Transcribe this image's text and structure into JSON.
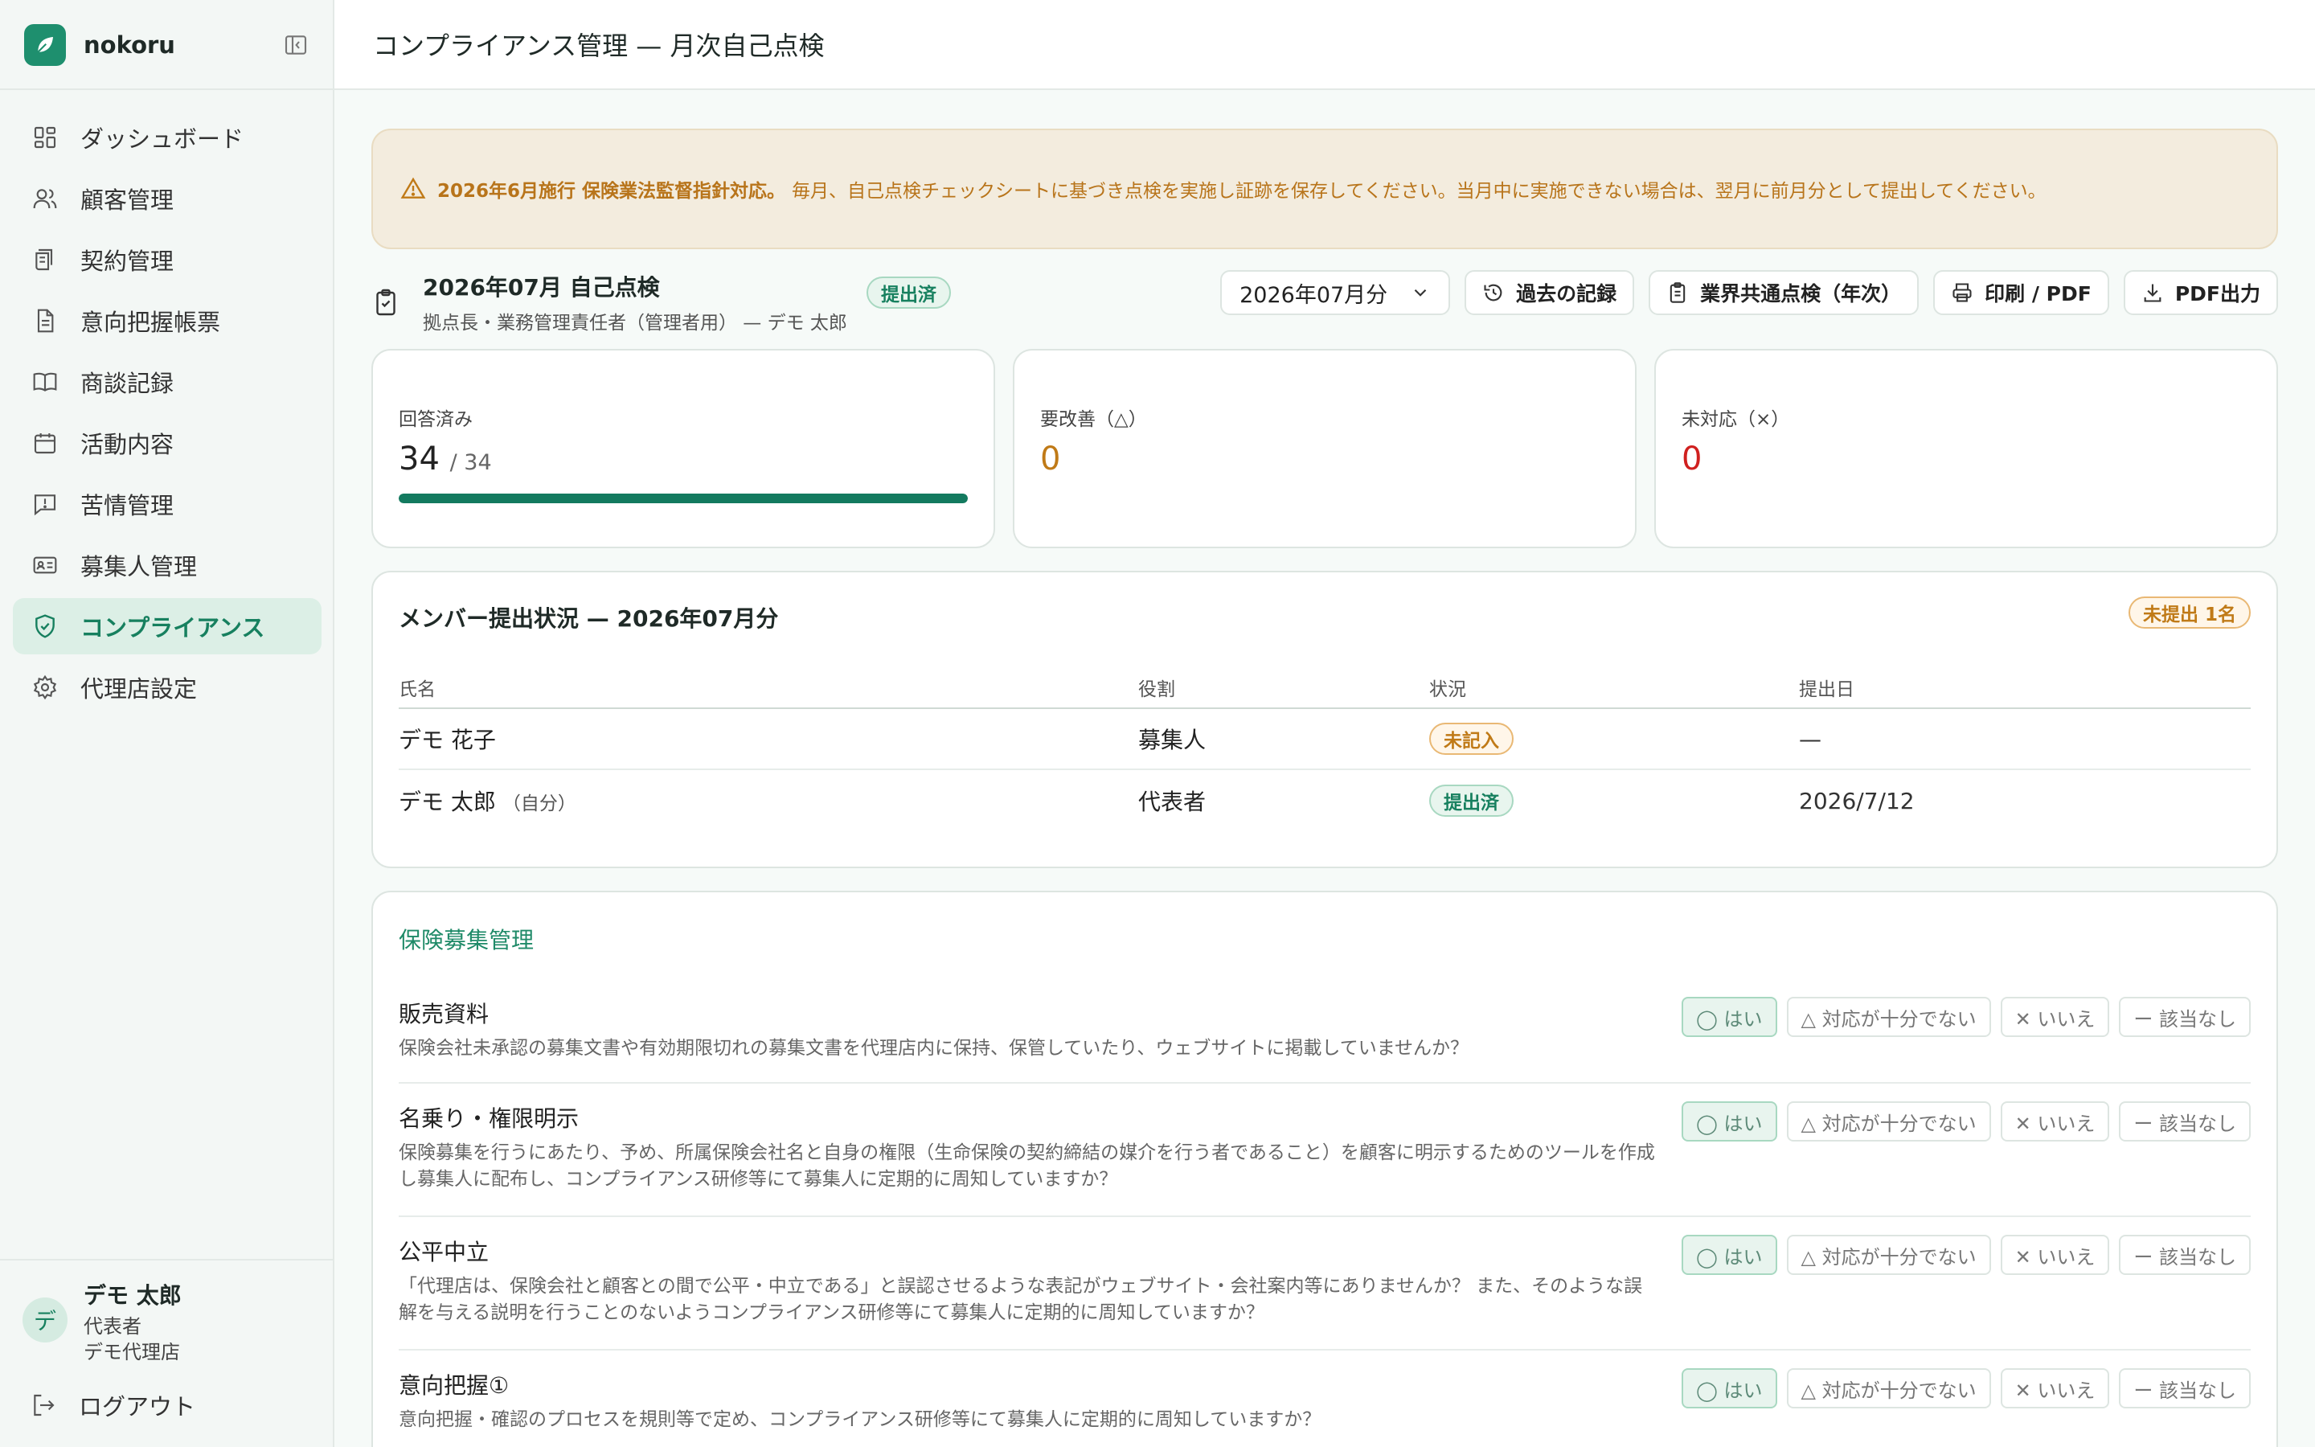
{
  "app": {
    "name": "nokoru"
  },
  "sidebar": {
    "items": [
      {
        "label": "ダッシュボード",
        "icon": "dashboard-icon"
      },
      {
        "label": "顧客管理",
        "icon": "users-icon"
      },
      {
        "label": "契約管理",
        "icon": "contract-icon"
      },
      {
        "label": "意向把握帳票",
        "icon": "document-icon"
      },
      {
        "label": "商談記録",
        "icon": "book-icon"
      },
      {
        "label": "活動内容",
        "icon": "calendar-icon"
      },
      {
        "label": "苦情管理",
        "icon": "alert-message-icon"
      },
      {
        "label": "募集人管理",
        "icon": "id-card-icon"
      },
      {
        "label": "コンプライアンス",
        "icon": "shield-icon",
        "active": true
      },
      {
        "label": "代理店設定",
        "icon": "gear-icon"
      }
    ],
    "user": {
      "initial": "デ",
      "name": "デモ 太郎",
      "role": "代表者",
      "org": "デモ代理店"
    },
    "logout_label": "ログアウト"
  },
  "header": {
    "title": "コンプライアンス管理 — 月次自己点検"
  },
  "alert": {
    "strong": "2026年6月施行 保険業法監督指針対応。",
    "text": "毎月、自己点検チェックシートに基づき点検を実施し証跡を保存してください。当月中に実施できない場合は、翌月に前月分として提出してください。"
  },
  "toolbar": {
    "title": "2026年07月 自己点検",
    "subtitle": "拠点長・業務管理責任者（管理者用） — デモ 太郎",
    "status_badge": "提出済",
    "month_select": "2026年07月分",
    "history_button": "過去の記録",
    "industry_button": "業界共通点検（年次）",
    "print_button": "印刷 / PDF",
    "pdf_button": "PDF出力"
  },
  "stats": {
    "answered": {
      "label": "回答済み",
      "value": "34",
      "total": "/ 34",
      "progress": 1.0
    },
    "needs_improvement": {
      "label": "要改善（△）",
      "value": "0",
      "color": "#c07a17"
    },
    "unhandled": {
      "label": "未対応（×）",
      "value": "0",
      "color": "#d0201f"
    }
  },
  "members": {
    "title": "メンバー提出状況 — 2026年07月分",
    "badge": "未提出 1名",
    "columns": [
      "氏名",
      "役割",
      "状況",
      "提出日"
    ],
    "rows": [
      {
        "name": "デモ 花子",
        "self": "",
        "role": "募集人",
        "status": "未記入",
        "status_type": "amber",
        "date": "—"
      },
      {
        "name": "デモ 太郎",
        "self": "（自分）",
        "role": "代表者",
        "status": "提出済",
        "status_type": "green",
        "date": "2026/7/12"
      }
    ]
  },
  "checklist": {
    "heading": "保険募集管理",
    "options": [
      "◯ はい",
      "△ 対応が十分でない",
      "✕ いいえ",
      "ー 該当なし"
    ],
    "items": [
      {
        "title": "販売資料",
        "desc": "保険会社未承認の募集文書や有効期限切れの募集文書を代理店内に保持、保管していたり、ウェブサイトに掲載していませんか？",
        "selected": 0
      },
      {
        "title": "名乗り・権限明示",
        "desc": "保険募集を行うにあたり、予め、所属保険会社名と自身の権限（生命保険の契約締結の媒介を行う者であること）を顧客に明示するためのツールを作成し募集人に配布し、コンプライアンス研修等にて募集人に定期的に周知していますか？",
        "selected": 0
      },
      {
        "title": "公平中立",
        "desc": "「代理店は、保険会社と顧客との間で公平・中立である」と誤認させるような表記がウェブサイト・会社案内等にありませんか？ また、そのような誤解を与える説明を行うことのないようコンプライアンス研修等にて募集人に定期的に周知していますか？",
        "selected": 0
      },
      {
        "title": "意向把握①",
        "desc": "意向把握・確認のプロセスを規則等で定め、コンプライアンス研修等にて募集人に定期的に周知していますか？",
        "selected": 0
      }
    ]
  },
  "colors": {
    "accent": "#17805f",
    "brand": "#1e8f6e",
    "warning": "#b8741a",
    "danger": "#d0201f"
  }
}
